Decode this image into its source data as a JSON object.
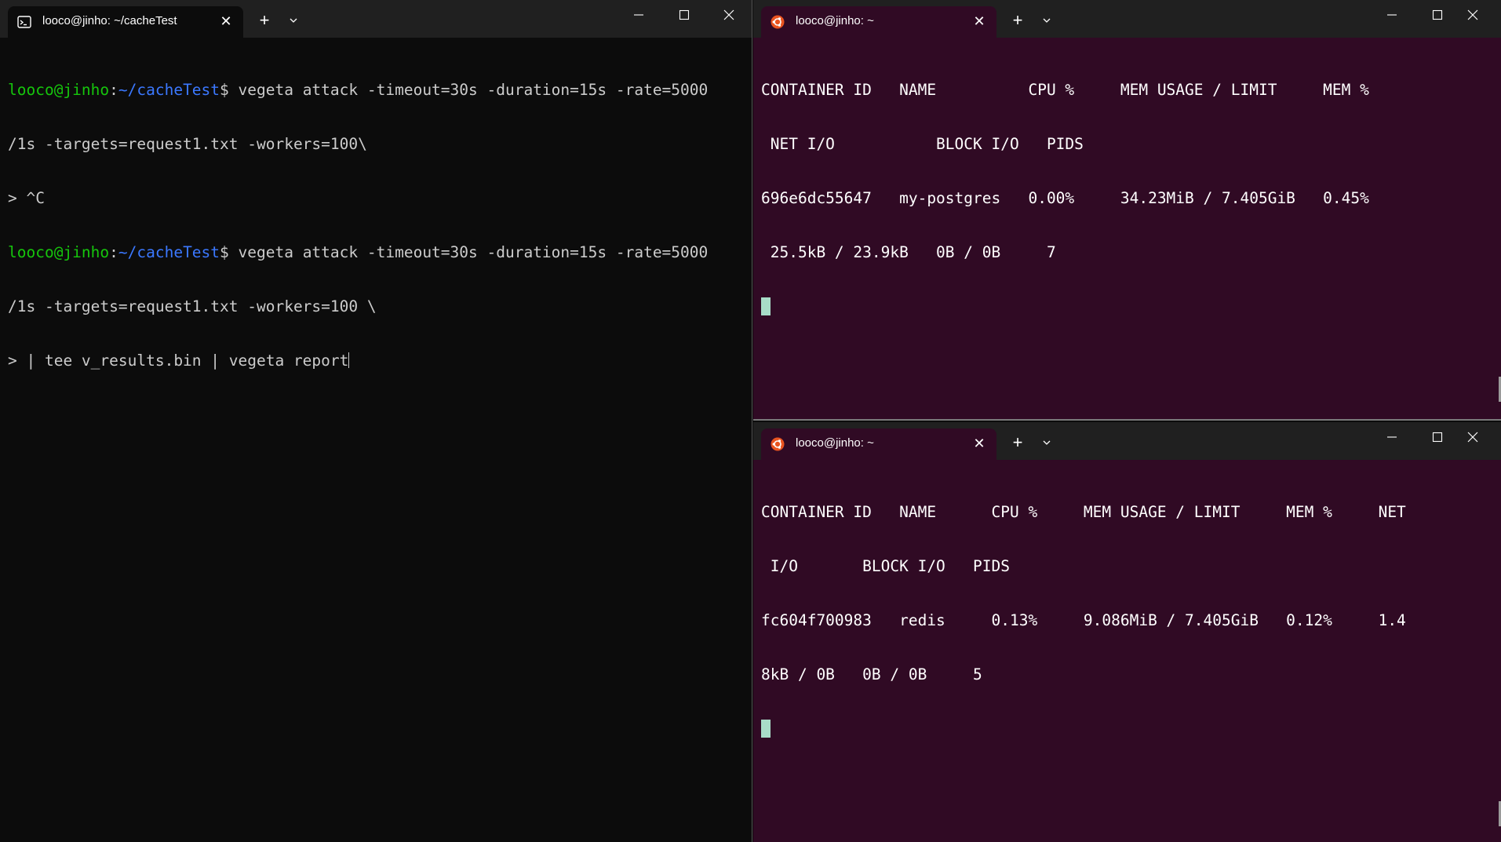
{
  "left_window": {
    "tab_title": "looco@jinho: ~/cacheTest",
    "tab_icon": "terminal-icon",
    "lines": [
      {
        "user": "looco@jinho",
        "sep": ":",
        "path": "~/cacheTest",
        "prompt": "$ ",
        "cmd": "vegeta attack -timeout=30s -duration=15s -rate=5000"
      },
      {
        "text": "/1s -targets=request1.txt -workers=100\\"
      },
      {
        "text": "> ^C"
      },
      {
        "user": "looco@jinho",
        "sep": ":",
        "path": "~/cacheTest",
        "prompt": "$ ",
        "cmd": "vegeta attack -timeout=30s -duration=15s -rate=5000"
      },
      {
        "text": "/1s -targets=request1.txt -workers=100 \\"
      },
      {
        "text": "> | tee v_results.bin | vegeta report"
      }
    ]
  },
  "top_right_window": {
    "tab_title": "looco@jinho: ~",
    "tab_icon": "ubuntu-icon",
    "lines": [
      "CONTAINER ID   NAME          CPU %     MEM USAGE / LIMIT     MEM %",
      " NET I/O           BLOCK I/O   PIDS",
      "696e6dc55647   my-postgres   0.00%     34.23MiB / 7.405GiB   0.45%",
      " 25.5kB / 23.9kB   0B / 0B     7"
    ]
  },
  "bottom_right_window": {
    "tab_title": "looco@jinho: ~",
    "tab_icon": "ubuntu-icon",
    "lines": [
      "CONTAINER ID   NAME      CPU %     MEM USAGE / LIMIT     MEM %     NET",
      " I/O       BLOCK I/O   PIDS",
      "fc604f700983   redis     0.13%     9.086MiB / 7.405GiB   0.12%     1.4",
      "8kB / 0B   0B / 0B     5"
    ]
  },
  "controls": {
    "close_glyph": "✕",
    "new_tab_glyph": "+",
    "dropdown_glyph": "⌄",
    "minimize_glyph": "—",
    "maximize_glyph": "☐",
    "window_close_glyph": "✕"
  },
  "colors": {
    "user": "#16c60c",
    "path": "#3b78ff",
    "ubuntu_bg": "#300a24",
    "cmd_bg": "#0c0c0c"
  }
}
